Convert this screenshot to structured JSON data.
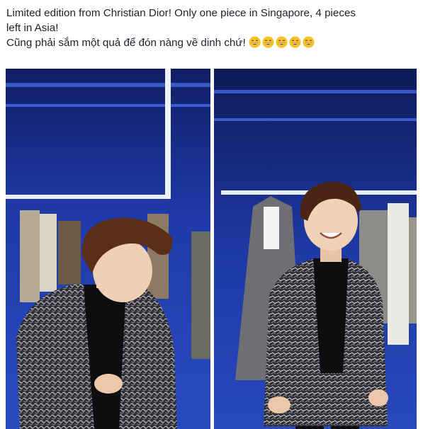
{
  "post": {
    "line1": "Limited edition from Christian Dior! Only one piece in Singapore, 4 pieces",
    "line2": "left in Asia!",
    "line3": "Cũng phải sắm một quả để đón nàng về dinh chứ!",
    "emoji_icon": "grinning-face-icon",
    "emoji_count": 5
  },
  "photos": [
    {
      "icon": "photo-man-looking-down"
    },
    {
      "icon": "photo-man-smiling"
    }
  ],
  "colors": {
    "text": "#1d2129",
    "store_blue": "#1f3aa8",
    "emoji_yellow": "#f7c22c"
  }
}
